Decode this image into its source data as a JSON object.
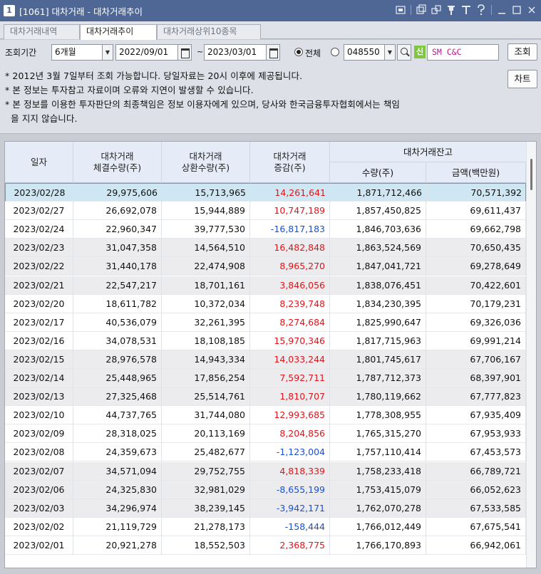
{
  "window": {
    "number": "1",
    "title": "[1061] 대차거래 - 대차거래추이",
    "icons": [
      "screen-icon",
      "copy-window-icon",
      "link-icon",
      "pin-icon",
      "text-size-icon",
      "help-icon",
      "minimize-icon",
      "maximize-icon",
      "close-icon"
    ]
  },
  "tabs": [
    {
      "label": "대차거래내역",
      "active": false
    },
    {
      "label": "대차거래추이",
      "active": true
    },
    {
      "label": "대차거래상위10종목",
      "active": false
    }
  ],
  "query": {
    "period_label": "조회기간",
    "period_value": "6개월",
    "start_date": "2022/09/01",
    "end_date": "2023/03/01",
    "tilde": "~",
    "radio_all_label": "전체",
    "radio_all_selected": true,
    "stock_code": "048550",
    "credit_badge": "신",
    "stock_name": "SM C&C",
    "search_button": "조회",
    "chart_button": "차트"
  },
  "notice": [
    "* 2012년 3월 7일부터 조회 가능합니다. 당일자료는 20시 이후에 제공됩니다.",
    "* 본 정보는 투자참고 자료이며 오류와 지연이 발생할 수 있습니다.",
    "* 본 정보를 이용한 투자판단의 최종책임은 정보 이용자에게 있으며, 당사와 한국금융투자협회에서는 책임",
    "  을 지지 않습니다."
  ],
  "table": {
    "headers": {
      "date": "일자",
      "contract": [
        "대차거래",
        "체결수량(주)"
      ],
      "repay": [
        "대차거래",
        "상환수량(주)"
      ],
      "change": [
        "대차거래",
        "증감(주)"
      ],
      "balance_group": "대차거래잔고",
      "balance_qty": "수량(주)",
      "balance_amt": "금액(백만원)"
    },
    "rows": [
      {
        "date": "2023/02/28",
        "contract": "29,975,606",
        "repay": "15,713,965",
        "change": "14,261,641",
        "sign": "pos",
        "qty": "1,871,712,466",
        "amt": "70,571,392"
      },
      {
        "date": "2023/02/27",
        "contract": "26,692,078",
        "repay": "15,944,889",
        "change": "10,747,189",
        "sign": "pos",
        "qty": "1,857,450,825",
        "amt": "69,611,437"
      },
      {
        "date": "2023/02/24",
        "contract": "22,960,347",
        "repay": "39,777,530",
        "change": "-16,817,183",
        "sign": "neg",
        "qty": "1,846,703,636",
        "amt": "69,662,798"
      },
      {
        "date": "2023/02/23",
        "contract": "31,047,358",
        "repay": "14,564,510",
        "change": "16,482,848",
        "sign": "pos",
        "qty": "1,863,524,569",
        "amt": "70,650,435"
      },
      {
        "date": "2023/02/22",
        "contract": "31,440,178",
        "repay": "22,474,908",
        "change": "8,965,270",
        "sign": "pos",
        "qty": "1,847,041,721",
        "amt": "69,278,649"
      },
      {
        "date": "2023/02/21",
        "contract": "22,547,217",
        "repay": "18,701,161",
        "change": "3,846,056",
        "sign": "pos",
        "qty": "1,838,076,451",
        "amt": "70,422,601"
      },
      {
        "date": "2023/02/20",
        "contract": "18,611,782",
        "repay": "10,372,034",
        "change": "8,239,748",
        "sign": "pos",
        "qty": "1,834,230,395",
        "amt": "70,179,231"
      },
      {
        "date": "2023/02/17",
        "contract": "40,536,079",
        "repay": "32,261,395",
        "change": "8,274,684",
        "sign": "pos",
        "qty": "1,825,990,647",
        "amt": "69,326,036"
      },
      {
        "date": "2023/02/16",
        "contract": "34,078,531",
        "repay": "18,108,185",
        "change": "15,970,346",
        "sign": "pos",
        "qty": "1,817,715,963",
        "amt": "69,991,214"
      },
      {
        "date": "2023/02/15",
        "contract": "28,976,578",
        "repay": "14,943,334",
        "change": "14,033,244",
        "sign": "pos",
        "qty": "1,801,745,617",
        "amt": "67,706,167"
      },
      {
        "date": "2023/02/14",
        "contract": "25,448,965",
        "repay": "17,856,254",
        "change": "7,592,711",
        "sign": "pos",
        "qty": "1,787,712,373",
        "amt": "68,397,901"
      },
      {
        "date": "2023/02/13",
        "contract": "27,325,468",
        "repay": "25,514,761",
        "change": "1,810,707",
        "sign": "pos",
        "qty": "1,780,119,662",
        "amt": "67,777,823"
      },
      {
        "date": "2023/02/10",
        "contract": "44,737,765",
        "repay": "31,744,080",
        "change": "12,993,685",
        "sign": "pos",
        "qty": "1,778,308,955",
        "amt": "67,935,409"
      },
      {
        "date": "2023/02/09",
        "contract": "28,318,025",
        "repay": "20,113,169",
        "change": "8,204,856",
        "sign": "pos",
        "qty": "1,765,315,270",
        "amt": "67,953,933"
      },
      {
        "date": "2023/02/08",
        "contract": "24,359,673",
        "repay": "25,482,677",
        "change": "-1,123,004",
        "sign": "neg",
        "qty": "1,757,110,414",
        "amt": "67,453,573"
      },
      {
        "date": "2023/02/07",
        "contract": "34,571,094",
        "repay": "29,752,755",
        "change": "4,818,339",
        "sign": "pos",
        "qty": "1,758,233,418",
        "amt": "66,789,721"
      },
      {
        "date": "2023/02/06",
        "contract": "24,325,830",
        "repay": "32,981,029",
        "change": "-8,655,199",
        "sign": "neg",
        "qty": "1,753,415,079",
        "amt": "66,052,623"
      },
      {
        "date": "2023/02/03",
        "contract": "34,296,974",
        "repay": "38,239,145",
        "change": "-3,942,171",
        "sign": "neg",
        "qty": "1,762,070,278",
        "amt": "67,533,585"
      },
      {
        "date": "2023/02/02",
        "contract": "21,119,729",
        "repay": "21,278,173",
        "change": "-158,444",
        "sign": "neg",
        "qty": "1,766,012,449",
        "amt": "67,675,541"
      },
      {
        "date": "2023/02/01",
        "contract": "20,921,278",
        "repay": "18,552,503",
        "change": "2,368,775",
        "sign": "pos",
        "qty": "1,766,170,893",
        "amt": "66,942,061"
      }
    ]
  },
  "colors": {
    "titlebar": "#4f6795",
    "positive": "#e0151b",
    "negative": "#1a4fd0",
    "selected_row": "#cfe7f2",
    "header_bg": "#e6ecf7"
  }
}
